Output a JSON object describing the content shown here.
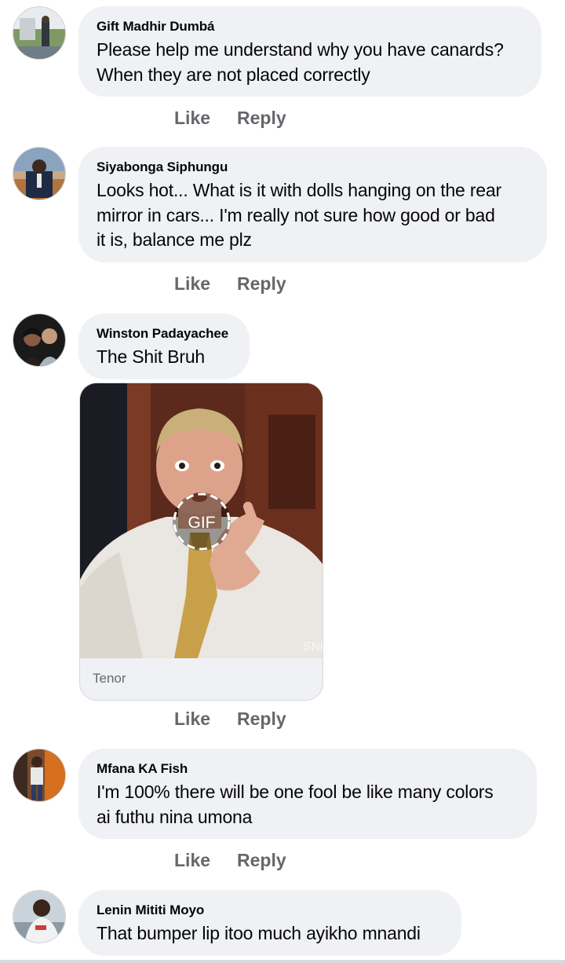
{
  "comments": [
    {
      "author": "Gift Madhir Dumbá",
      "text": "Please help me understand why you have canards?\nWhen they are not placed correctly",
      "like": "Like",
      "reply": "Reply"
    },
    {
      "author": "Siyabonga Siphungu",
      "text": "Looks hot... What is it with dolls hanging on the rear\nmirror in cars... I'm really not sure how good or bad\nit is, balance me plz",
      "like": "Like",
      "reply": "Reply"
    },
    {
      "author": "Winston Padayachee",
      "text": "The Shit Bruh",
      "like": "Like",
      "reply": "Reply",
      "gif": {
        "badge": "GIF",
        "provider": "Tenor",
        "watermark": "SNL"
      }
    },
    {
      "author": "Mfana KA Fish",
      "text": "I'm 100% there will be one fool be like many colors\nai futhu nina umona",
      "like": "Like",
      "reply": "Reply"
    },
    {
      "author": "Lenin Mititi Moyo",
      "text": "That bumper lip itoo much ayikho mnandi"
    }
  ],
  "colors": {
    "bubble": "#eff1f4",
    "secondary_text": "#65676b",
    "primary_text": "#050505"
  }
}
